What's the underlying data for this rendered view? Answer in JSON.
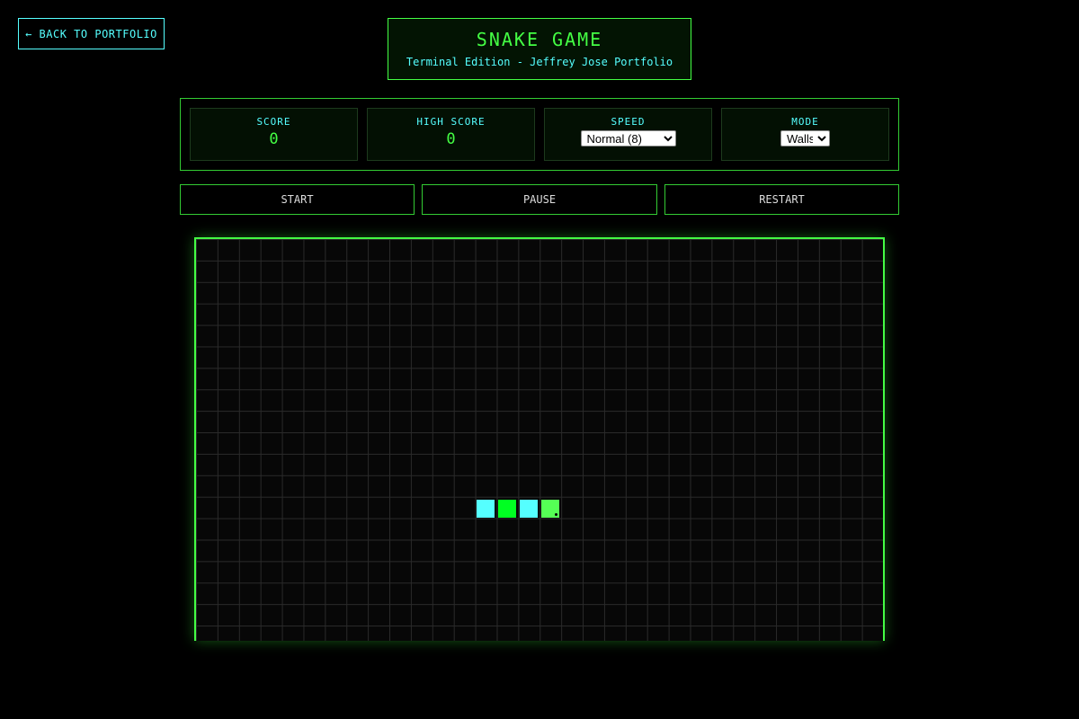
{
  "nav": {
    "back_label": "← BACK TO PORTFOLIO"
  },
  "header": {
    "title": "SNAKE GAME",
    "subtitle": "Terminal Edition - Jeffrey Jose Portfolio"
  },
  "stats": {
    "score_label": "SCORE",
    "score_value": "0",
    "high_score_label": "HIGH SCORE",
    "high_score_value": "0",
    "speed_label": "SPEED",
    "speed_selected": "Normal (8)",
    "mode_label": "MODE",
    "mode_selected": "Walls"
  },
  "controls": {
    "start_label": "START",
    "pause_label": "PAUSE",
    "restart_label": "RESTART"
  },
  "snake": {
    "segment_colors": [
      "#55ffff",
      "#00ff22",
      "#55ffff",
      "#55ff55"
    ]
  },
  "colors": {
    "accent_green": "#44ff44",
    "accent_cyan": "#55ffff",
    "background": "#000000"
  }
}
